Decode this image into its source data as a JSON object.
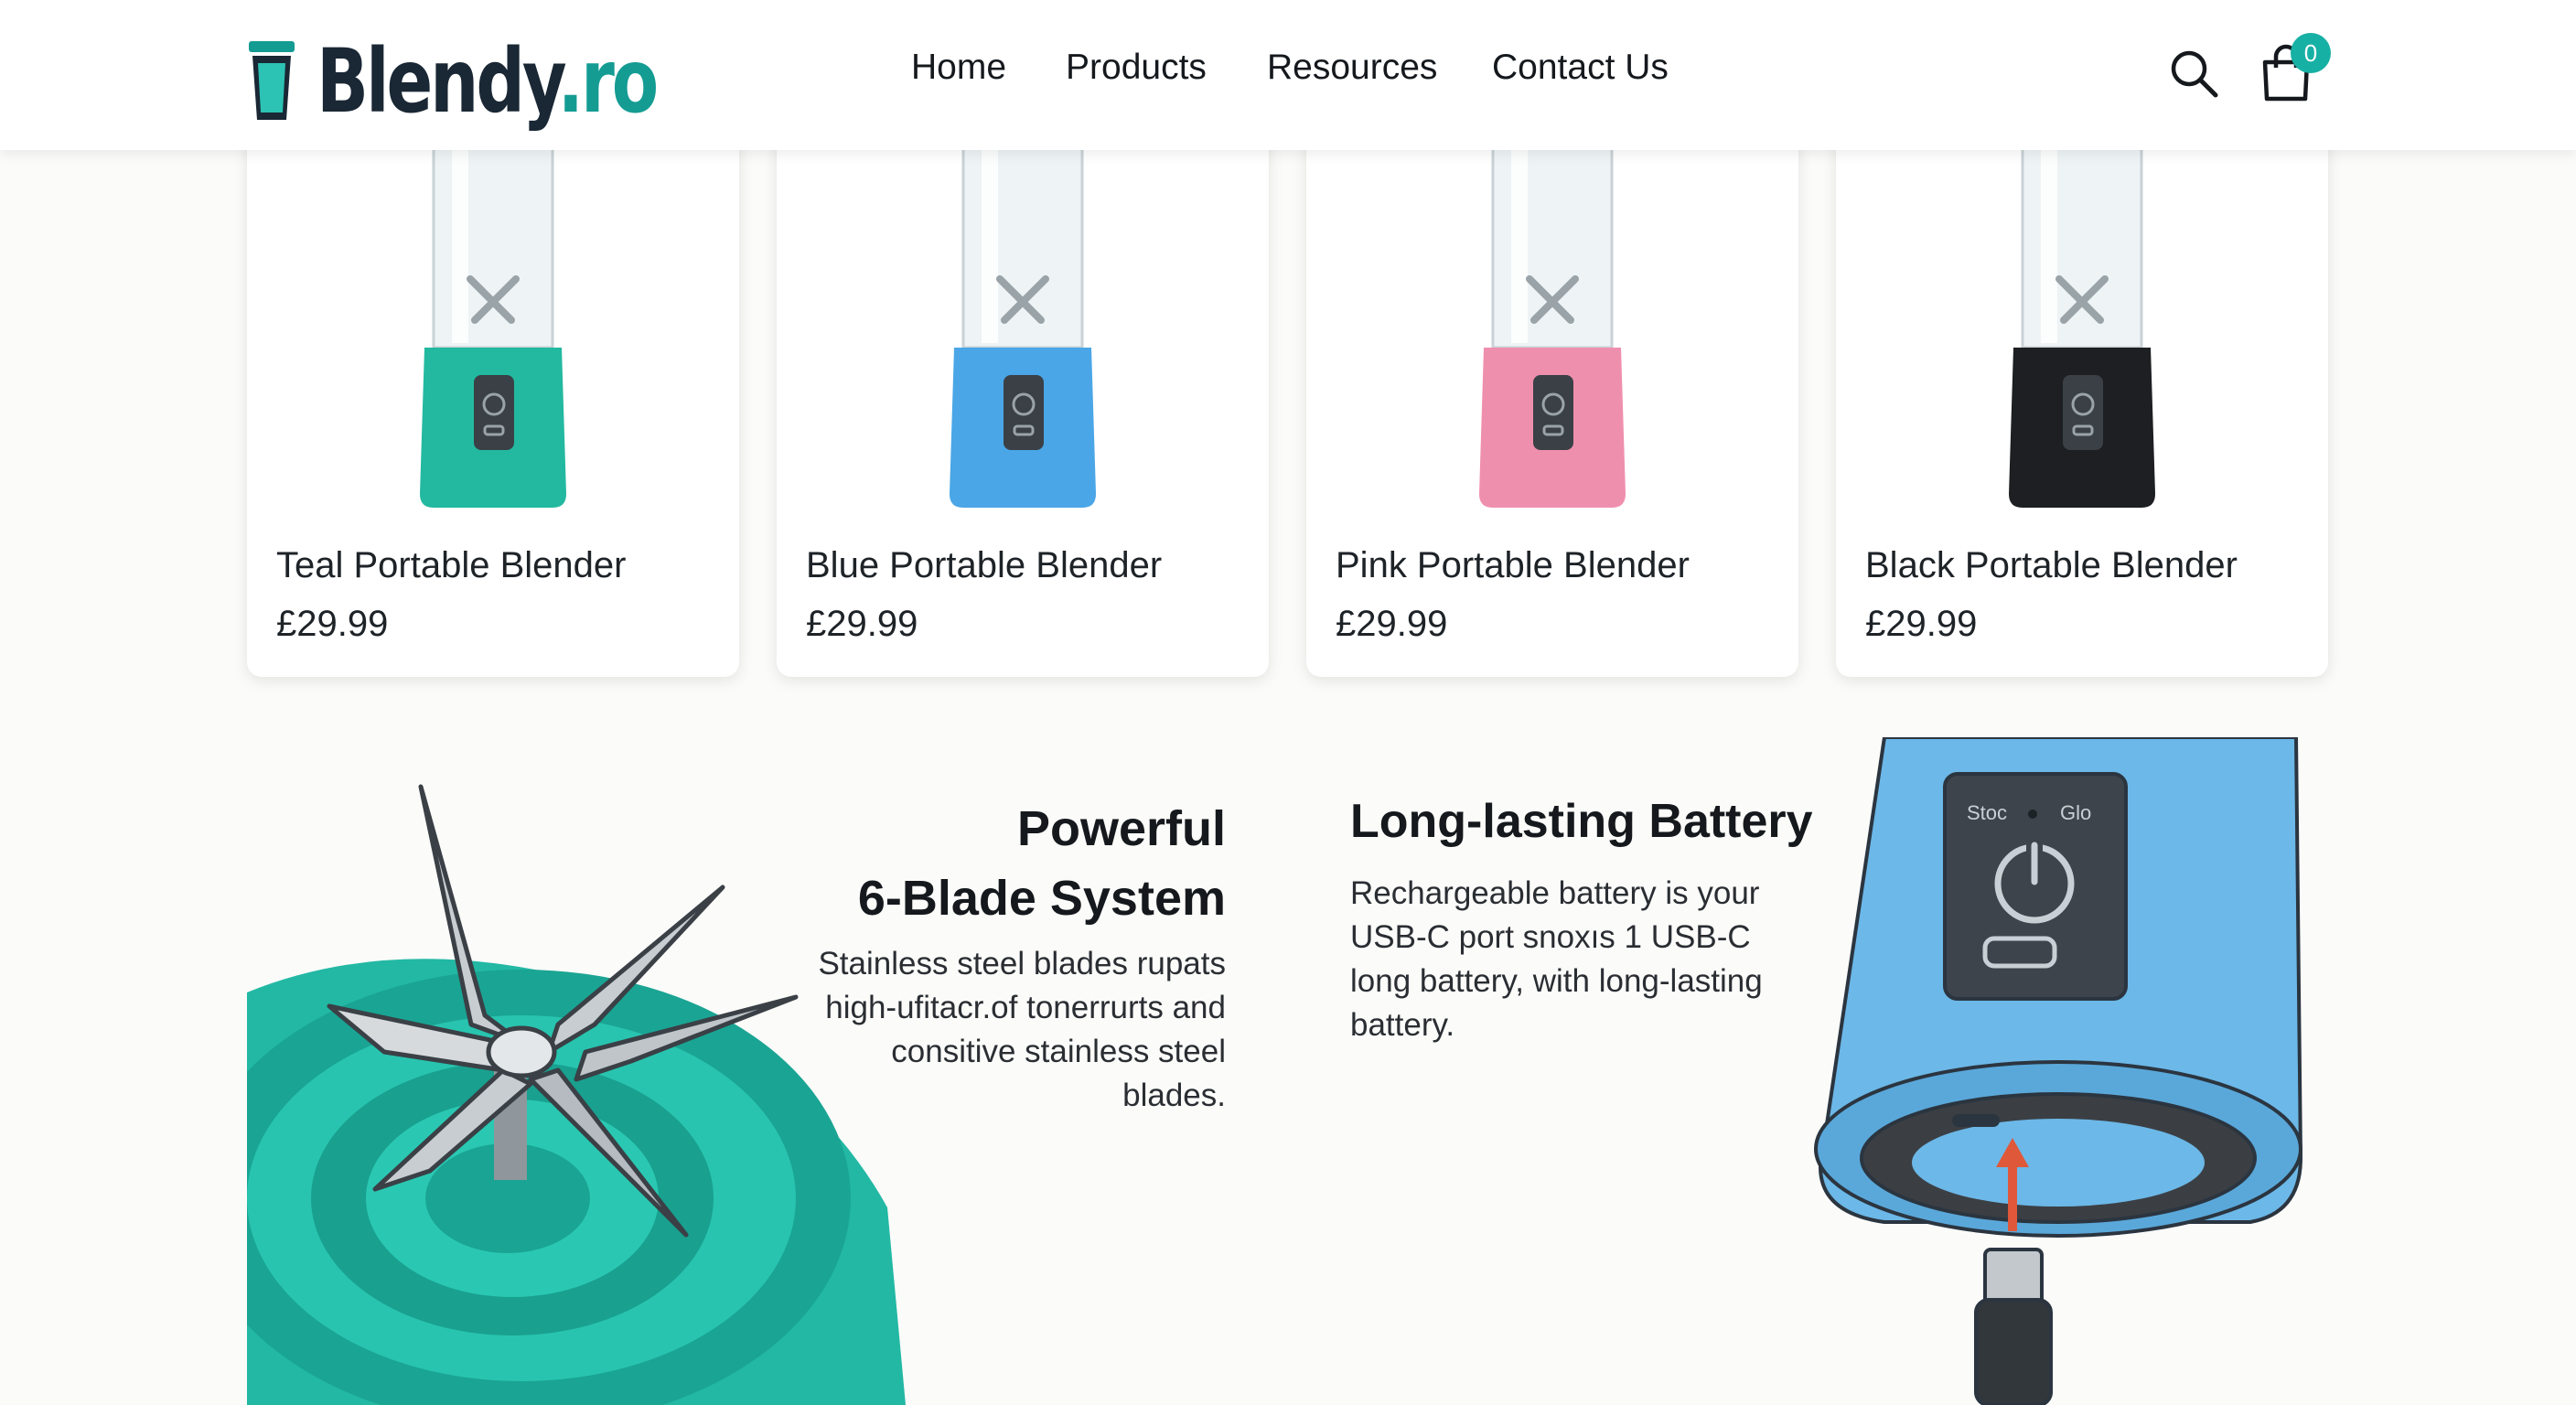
{
  "brand": {
    "name": "Blendy",
    "tld": ".ro"
  },
  "nav": [
    {
      "label": "Home"
    },
    {
      "label": "Products"
    },
    {
      "label": "Resources"
    },
    {
      "label": "Contact Us"
    }
  ],
  "cart": {
    "count": "0"
  },
  "products": [
    {
      "name": "Teal Portable Blender",
      "price": "£29.99",
      "color": "#23b9a0",
      "strap": "#3ecfb9"
    },
    {
      "name": "Blue Portable Blender",
      "price": "£29.99",
      "color": "#4aa6e6",
      "strap": "#5bbdf0"
    },
    {
      "name": "Pink Portable Blender",
      "price": "£29.99",
      "color": "#ef8fae",
      "strap": "#f28fb2"
    },
    {
      "name": "Black Portable Blender",
      "price": "£29.99",
      "color": "#1d1f22",
      "strap": "#1b1b1b"
    }
  ],
  "features": {
    "blades": {
      "title_line1": "Powerful",
      "title_line2": "6-Blade System",
      "description": "Stainless steel blades rupats high-ufitacr.of tonerrurts and consitive stainless steel blades."
    },
    "battery": {
      "title": "Long-lasting Battery",
      "description": "Rechargeable battery is your USB-C port snoxıs 1 USB-C long battery, with long-lasting battery.",
      "panel_left": "Stoc",
      "panel_right": "Glo"
    }
  },
  "colors": {
    "accent": "#149c93",
    "badge": "#17b0a4",
    "teal": "#23b9a0",
    "blue_unit": "#6cb8e8"
  }
}
